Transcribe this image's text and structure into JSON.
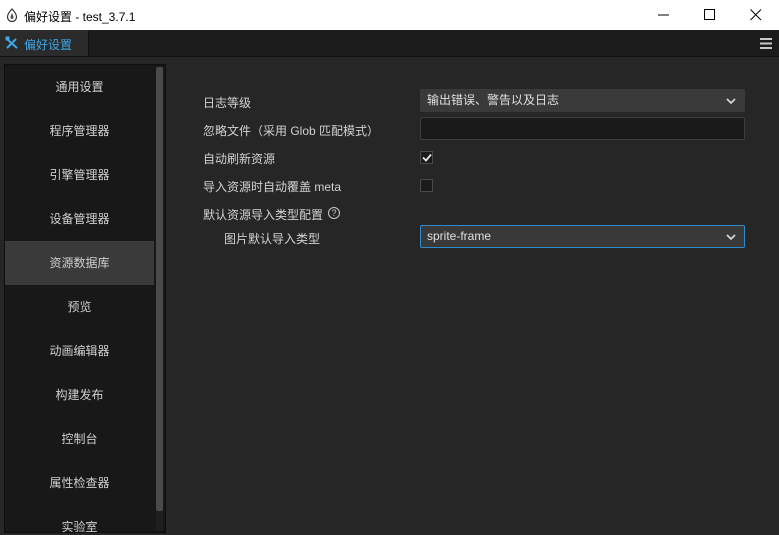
{
  "window": {
    "title": "偏好设置 - test_3.7.1"
  },
  "tab": {
    "label": "偏好设置",
    "accent": "#3ea7e6"
  },
  "sidebar": {
    "items": [
      {
        "label": "通用设置"
      },
      {
        "label": "程序管理器"
      },
      {
        "label": "引擎管理器"
      },
      {
        "label": "设备管理器"
      },
      {
        "label": "资源数据库",
        "active": true
      },
      {
        "label": "预览"
      },
      {
        "label": "动画编辑器"
      },
      {
        "label": "构建发布"
      },
      {
        "label": "控制台"
      },
      {
        "label": "属性检查器"
      },
      {
        "label": "实验室"
      }
    ]
  },
  "settings": {
    "log_level": {
      "label": "日志等级",
      "value": "输出错误、警告以及日志"
    },
    "ignore_files": {
      "label": "忽略文件（采用 Glob 匹配模式）",
      "value": ""
    },
    "auto_refresh": {
      "label": "自动刷新资源",
      "checked": true
    },
    "auto_overwrite_meta": {
      "label": "导入资源时自动覆盖 meta",
      "checked": false
    },
    "default_import": {
      "label": "默认资源导入类型配置",
      "image_label": "图片默认导入类型",
      "image_value": "sprite-frame"
    }
  }
}
